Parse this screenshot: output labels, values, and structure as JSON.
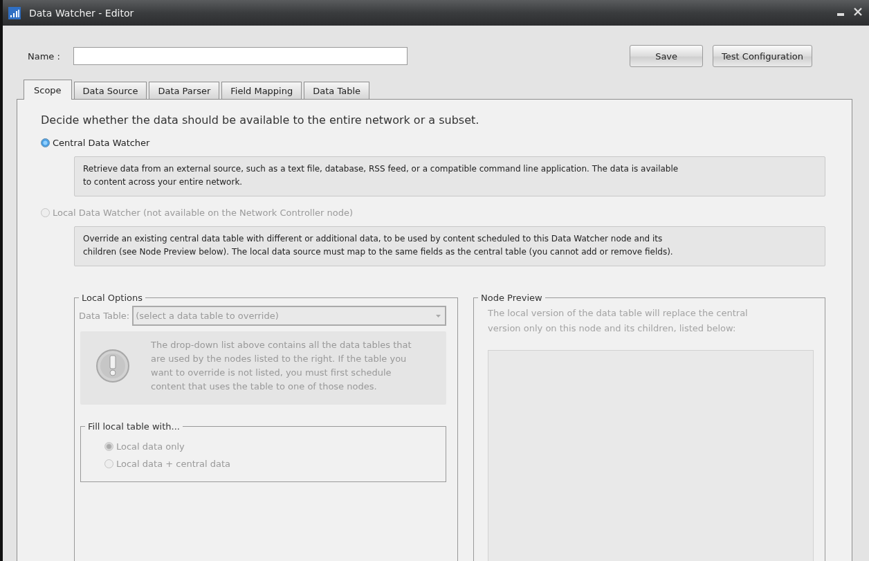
{
  "window": {
    "title": "Data Watcher - Editor"
  },
  "name_field": {
    "label": "Name :"
  },
  "buttons": [
    "Save",
    "Test Configuration"
  ],
  "tabs": [
    {
      "label": "Scope",
      "selected": true
    },
    {
      "label": "Data Source",
      "selected": false
    },
    {
      "label": "Data Parser",
      "selected": false
    },
    {
      "label": "Field Mapping",
      "selected": false
    },
    {
      "label": "Data Table",
      "selected": false
    }
  ],
  "scope": {
    "heading": "Decide whether the data should be available to the entire network or a subset.",
    "options": [
      {
        "label": "Central Data Watcher",
        "selected": true,
        "disabled": false,
        "description": "Retrieve data from an external source, such as a text file, database, RSS feed, or a compatible command line application. The data is available\nto content across your entire network."
      },
      {
        "label": "Local Data Watcher (not available on the Network Controller node)",
        "selected": false,
        "disabled": true,
        "description": "Override an existing central data table with different or additional data, to be used by content scheduled to this Data Watcher node and its\nchildren (see Node Preview below). The local data source must map to the same fields as the central table (you cannot add or remove fields)."
      }
    ],
    "local_options": {
      "title": "Local Options",
      "data_table_label": "Data Table:",
      "data_table_placeholder": "(select a data table to override)",
      "info": "The drop-down list above contains all the data tables that\nare used by the nodes listed to the right. If the table you\nwant to override is not listed, you must first schedule\ncontent that uses the table to one of those nodes.",
      "fill": {
        "title": "Fill local table with...",
        "options": [
          {
            "label": "Local data only",
            "selected": true,
            "disabled": true
          },
          {
            "label": "Local data + central data",
            "selected": false,
            "disabled": true
          }
        ]
      }
    },
    "node_preview": {
      "title": "Node Preview",
      "text": "The local version of the data table will replace the central\nversion only on this node and its children, listed below:"
    }
  }
}
